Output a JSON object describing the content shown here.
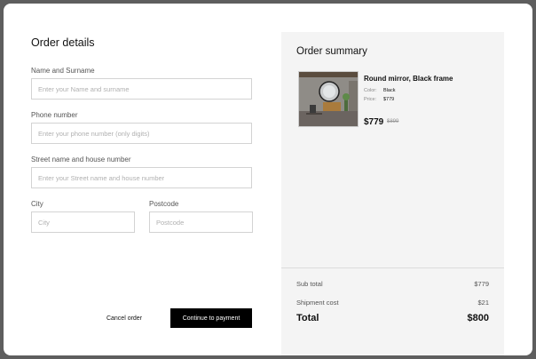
{
  "order_details": {
    "title": "Order details",
    "fields": {
      "name": {
        "label": "Name and Surname",
        "placeholder": "Enter your Name and surname",
        "value": ""
      },
      "phone": {
        "label": "Phone number",
        "placeholder": "Enter your phone number (only digits)",
        "value": ""
      },
      "street": {
        "label": "Street name and house number",
        "placeholder": "Enter your Street name and house number",
        "value": ""
      },
      "city": {
        "label": "City",
        "placeholder": "City",
        "value": ""
      },
      "postcode": {
        "label": "Postcode",
        "placeholder": "Postcode",
        "value": ""
      }
    },
    "cancel_label": "Cancel order",
    "continue_label": "Continue to payment"
  },
  "order_summary": {
    "title": "Order summary",
    "product": {
      "name": "Round mirror, Black frame",
      "color_label": "Color:",
      "color_value": "Black",
      "price_label": "Price:",
      "price_value": "$779",
      "price_now": "$779",
      "price_old": "$899"
    },
    "subtotal_label": "Sub total",
    "subtotal_value": "$779",
    "shipping_label": "Shipment cost",
    "shipping_value": "$21",
    "total_label": "Total",
    "total_value": "$800"
  },
  "colors": {
    "background": "#5e5e5e",
    "panel": "#ffffff",
    "summary_bg": "#f4f4f4",
    "primary_button": "#000000"
  }
}
